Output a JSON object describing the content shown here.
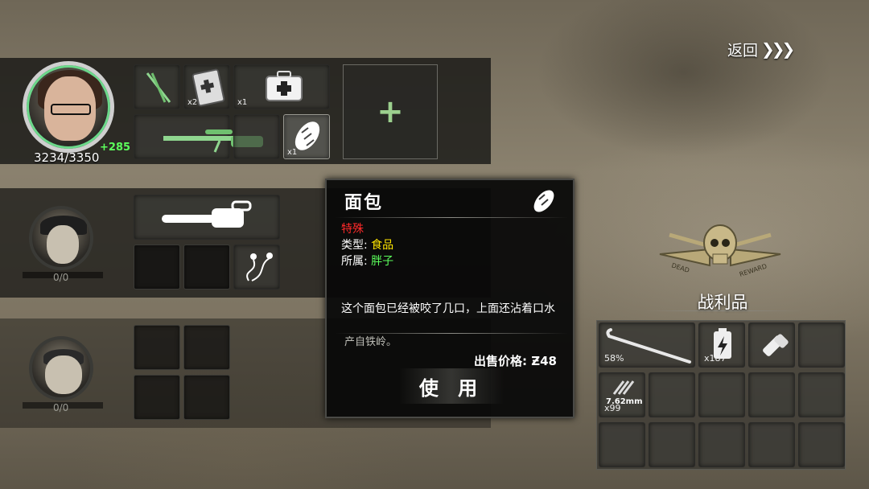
{
  "header": {
    "back_label": "返回",
    "back_chevrons": "❯❯❯"
  },
  "characters": [
    {
      "hp": "3234/3350",
      "hp_gain": "+285"
    },
    {
      "hp": "0/0"
    },
    {
      "hp": "0/0"
    }
  ],
  "inventory": {
    "row1_qty": [
      "",
      "x2",
      "x1",
      "",
      "",
      "",
      "",
      "x1"
    ],
    "add_label": "+"
  },
  "popup": {
    "title": "面包",
    "rarity": "特殊",
    "type_label": "类型:",
    "type_value": "食品",
    "owner_label": "所属:",
    "owner_value": "胖子",
    "description": "这个面包已经被咬了几口，上面还沾着口水",
    "origin": "产自铁岭。",
    "price_label": "出售价格:",
    "price_value": "Ƶ48",
    "use_button": "使 用"
  },
  "loot": {
    "title": "战利品",
    "emblem_left": "DEAD",
    "emblem_right": "REWARD",
    "slot_labels": [
      "58%",
      "x187",
      "7.62mm",
      "x99"
    ]
  },
  "colors": {
    "rarity": "#ff2a2a",
    "type_value": "#ffe600",
    "owner_value": "#5cff5c",
    "hp_gain": "#5cff5c"
  }
}
